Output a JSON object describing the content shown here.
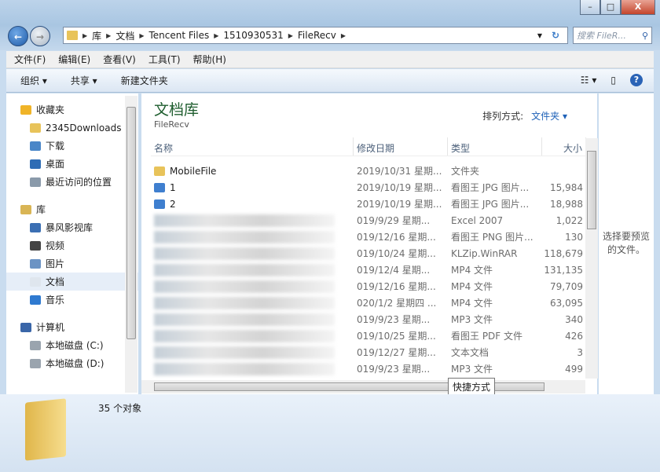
{
  "window": {
    "minimize": "–",
    "maximize": "□",
    "close": "X"
  },
  "address": {
    "crumbs": [
      "库",
      "文档",
      "Tencent Files",
      "1510930531",
      "FileRecv"
    ],
    "search_placeholder": "搜索 FileR..."
  },
  "menu": [
    "文件(F)",
    "编辑(E)",
    "查看(V)",
    "工具(T)",
    "帮助(H)"
  ],
  "toolbar": {
    "organize": "组织 ▾",
    "share": "共享 ▾",
    "new_folder": "新建文件夹",
    "help": "?"
  },
  "sidebar": {
    "items": [
      {
        "label": "收藏夹",
        "icon": "star-icon",
        "top": true
      },
      {
        "label": "2345Downloads",
        "icon": "folder-icon"
      },
      {
        "label": "下载",
        "icon": "downloads-icon"
      },
      {
        "label": "桌面",
        "icon": "desktop-icon"
      },
      {
        "label": "最近访问的位置",
        "icon": "recent-icon"
      },
      {
        "label": "",
        "spacer": true
      },
      {
        "label": "库",
        "icon": "library-icon",
        "top": true
      },
      {
        "label": "暴风影视库",
        "icon": "video-library-icon"
      },
      {
        "label": "视频",
        "icon": "video-icon"
      },
      {
        "label": "图片",
        "icon": "pictures-icon"
      },
      {
        "label": "文档",
        "icon": "document-icon",
        "selected": true
      },
      {
        "label": "音乐",
        "icon": "music-icon"
      },
      {
        "label": "",
        "spacer": true
      },
      {
        "label": "计算机",
        "icon": "computer-icon",
        "top": true
      },
      {
        "label": "本地磁盘 (C:)",
        "icon": "drive-icon"
      },
      {
        "label": "本地磁盘 (D:)",
        "icon": "drive-icon"
      }
    ]
  },
  "main": {
    "title": "文档库",
    "subtitle": "FileRecv",
    "arrange_label": "排列方式:",
    "arrange_value": "文件夹 ▾",
    "columns": [
      "名称",
      "修改日期",
      "类型",
      "大小"
    ],
    "rows": [
      {
        "name": "MobileFile",
        "icon": "folder-icon",
        "date": "2019/10/31 星期...",
        "type": "文件夹",
        "size": ""
      },
      {
        "name": "1",
        "icon": "jpg-icon",
        "date": "2019/10/19 星期...",
        "type": "看图王 JPG 图片...",
        "size": "15,984"
      },
      {
        "name": "2",
        "icon": "jpg-icon",
        "date": "2019/10/19 星期...",
        "type": "看图王 JPG 图片...",
        "size": "18,988"
      },
      {
        "name": "",
        "blurred": true,
        "date": "019/9/29 星期...",
        "type": "Excel 2007",
        "size": "1,022"
      },
      {
        "name": "",
        "blurred": true,
        "date": "019/12/16 星期...",
        "type": "看图王 PNG 图片...",
        "size": "130"
      },
      {
        "name": "",
        "blurred": true,
        "date": "019/10/24 星期...",
        "type": "KLZip.WinRAR",
        "size": "118,679"
      },
      {
        "name": "",
        "blurred": true,
        "date": "019/12/4 星期...",
        "type": "MP4 文件",
        "size": "131,135"
      },
      {
        "name": "",
        "blurred": true,
        "date": "019/12/16 星期...",
        "type": "MP4 文件",
        "size": "79,709"
      },
      {
        "name": "",
        "blurred": true,
        "date": "020/1/2 星期四 ...",
        "type": "MP4 文件",
        "size": "63,095"
      },
      {
        "name": "",
        "blurred": true,
        "date": "019/9/23 星期...",
        "type": "MP3 文件",
        "size": "340"
      },
      {
        "name": "",
        "blurred": true,
        "date": "019/10/25 星期...",
        "type": "看图王 PDF 文件",
        "size": "426"
      },
      {
        "name": "",
        "blurred": true,
        "date": "019/12/27 星期...",
        "type": "文本文档",
        "size": "3"
      },
      {
        "name": "",
        "blurred": true,
        "date": "019/9/23 星期...",
        "type": "MP3 文件",
        "size": "499"
      }
    ],
    "tooltip": "快捷方式"
  },
  "preview": {
    "text": "选择要预览的文件。"
  },
  "status": {
    "count": "35 个对象"
  }
}
